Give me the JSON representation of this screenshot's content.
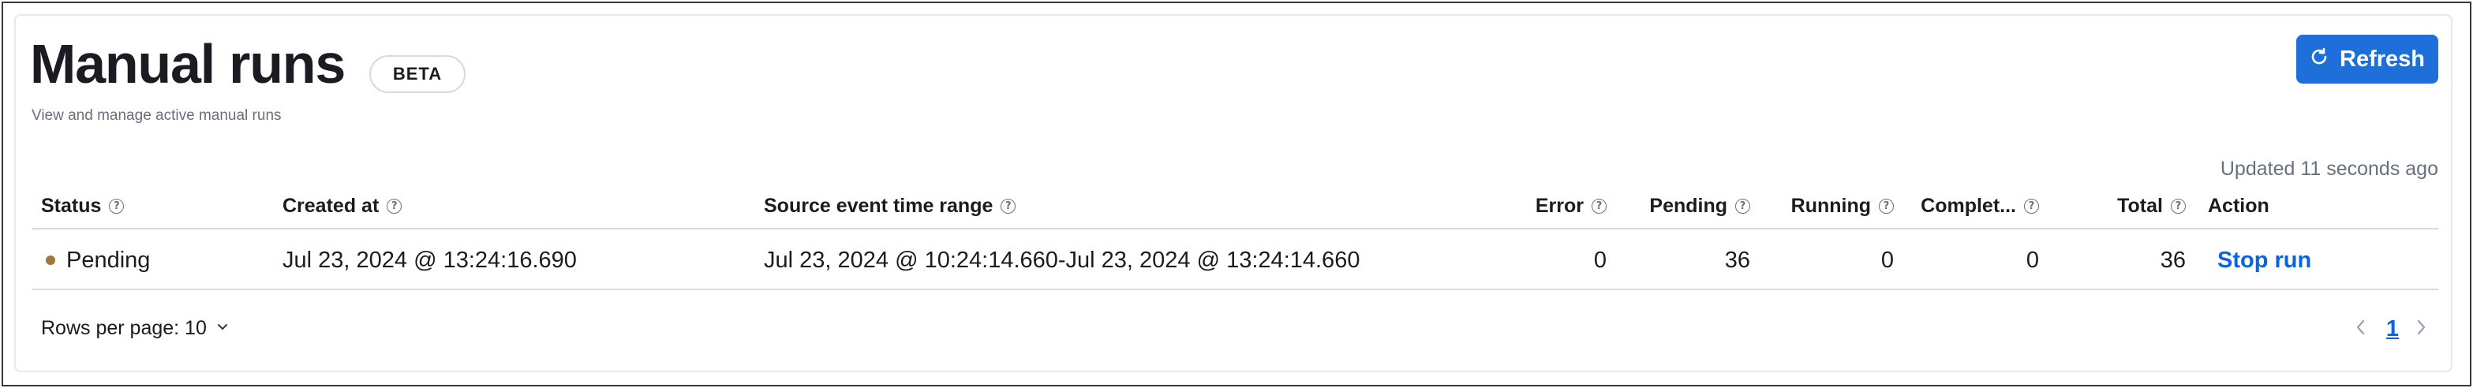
{
  "page": {
    "title": "Manual runs",
    "badge": "BETA",
    "subtitle": "View and manage active manual runs",
    "refresh_label": "Refresh",
    "updated_text": "Updated 11 seconds ago"
  },
  "table": {
    "columns": {
      "status": "Status",
      "created_at": "Created at",
      "source_range": "Source event time range",
      "error": "Error",
      "pending": "Pending",
      "running": "Running",
      "completed": "Complet...",
      "total": "Total",
      "action": "Action"
    },
    "rows": [
      {
        "status": "Pending",
        "created_at": "Jul 23, 2024 @ 13:24:16.690",
        "source_range": "Jul 23, 2024 @ 10:24:14.660-Jul 23, 2024 @ 13:24:14.660",
        "error": "0",
        "pending": "36",
        "running": "0",
        "completed": "0",
        "total": "36",
        "action": "Stop run"
      }
    ]
  },
  "pagination": {
    "rows_per_page_label": "Rows per page: 10",
    "current_page": "1"
  },
  "colors": {
    "primary": "#1e6fd9",
    "link": "#0b64dd",
    "pending_dot": "#9b7a3a",
    "muted_text": "#69707d",
    "border": "#d3dae6"
  },
  "icons": {
    "refresh": "refresh-icon",
    "help": "question-circle-icon",
    "status": "status-dot-icon",
    "rows_dropdown": "chevron-down-icon",
    "prev": "chevron-left-icon",
    "next": "chevron-right-icon"
  }
}
